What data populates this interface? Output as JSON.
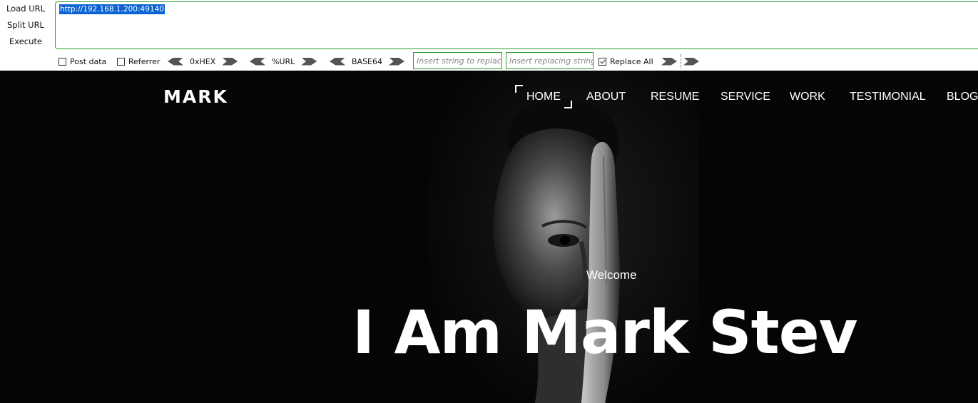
{
  "hackbar": {
    "actions": [
      "Load URL",
      "Split URL",
      "Execute"
    ],
    "url": "http://192.168.1.200:49140",
    "post_data_label": "Post data",
    "referrer_label": "Referrer",
    "hex_label": "0xHEX",
    "url_enc_label": "%URL",
    "base64_label": "BASE64",
    "replace_placeholder": "Insert string to replace",
    "replacing_placeholder": "Insert replacing string",
    "replace_all_label": "Replace All",
    "post_data_checked": false,
    "referrer_checked": false,
    "replace_all_checked": true
  },
  "site": {
    "logo": "MARK",
    "nav": [
      "HOME",
      "ABOUT",
      "RESUME",
      "SERVICE",
      "WORK",
      "TESTIMONIAL",
      "BLOG"
    ],
    "active_nav": "HOME",
    "welcome": "Welcome",
    "headline": "I Am Mark Stev"
  },
  "colors": {
    "accent_border": "#2f9a2f",
    "selection": "#0a63d4",
    "site_background": "#050505"
  }
}
